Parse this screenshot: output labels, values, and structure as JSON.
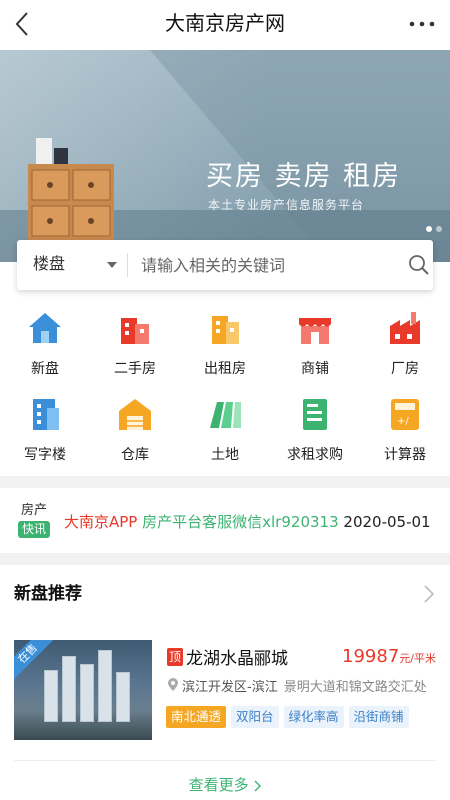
{
  "header": {
    "title": "大南京房产网"
  },
  "banner": {
    "headline": "买房 卖房 租房",
    "subline": "本土专业房产信息服务平台"
  },
  "search": {
    "type_label": "楼盘",
    "placeholder": "请输入相关的关键词"
  },
  "categories": [
    {
      "label": "新盘",
      "icon": "house-icon",
      "color": "#3b8fd9"
    },
    {
      "label": "二手房",
      "icon": "building-icon",
      "color": "#e8392a"
    },
    {
      "label": "出租房",
      "icon": "building-icon",
      "color": "#f5a623"
    },
    {
      "label": "商铺",
      "icon": "shop-icon",
      "color": "#e8392a"
    },
    {
      "label": "厂房",
      "icon": "factory-icon",
      "color": "#e8392a"
    },
    {
      "label": "写字楼",
      "icon": "office-icon",
      "color": "#3b8fd9"
    },
    {
      "label": "仓库",
      "icon": "warehouse-icon",
      "color": "#f5a623"
    },
    {
      "label": "土地",
      "icon": "land-icon",
      "color": "#3cb371"
    },
    {
      "label": "求租求购",
      "icon": "document-icon",
      "color": "#3cb371"
    },
    {
      "label": "计算器",
      "icon": "calculator-icon",
      "color": "#f5a623"
    }
  ],
  "news": {
    "tag_top": "房产",
    "tag_badge": "快讯",
    "brand": "大南京APP",
    "text": "房产平台客服微信xlr920313",
    "date": "2020-05-01"
  },
  "new_homes": {
    "title": "新盘推荐",
    "listing": {
      "ribbon": "在售",
      "badge": "顶",
      "name": "龙湖水晶郦城",
      "price": "19987",
      "price_unit": "元/平米",
      "district": "滨江开发区-滨江",
      "address": "景明大道和锦文路交汇处",
      "tags": [
        "南北通透",
        "双阳台",
        "绿化率高",
        "沿街商铺"
      ]
    },
    "more_label": "查看更多"
  }
}
